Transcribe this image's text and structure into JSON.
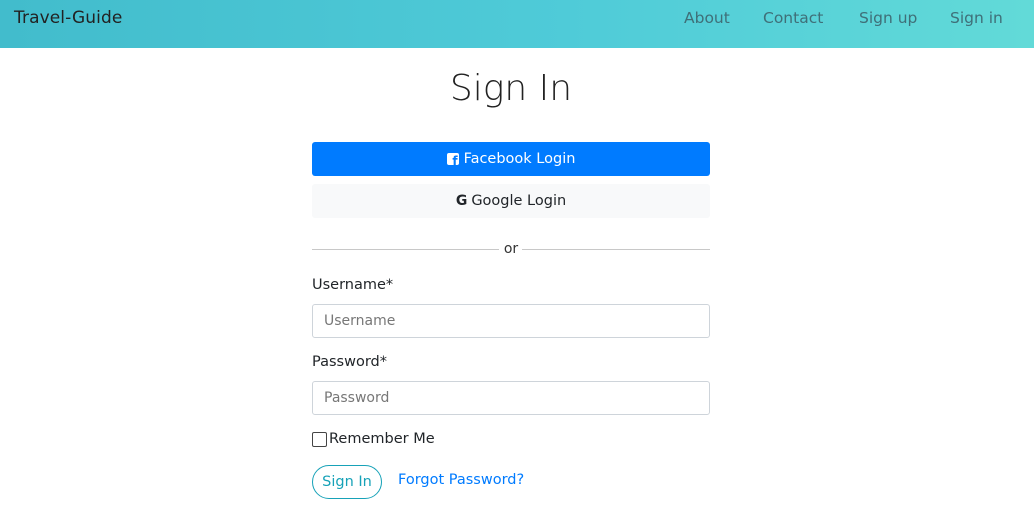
{
  "navbar": {
    "brand": "Travel-Guide",
    "links": [
      "About",
      "Contact",
      "Sign up",
      "Sign in"
    ]
  },
  "page": {
    "title": "Sign In"
  },
  "social": {
    "facebook_label": "Facebook Login",
    "google_label": "Google Login",
    "facebook_color": "#007bff"
  },
  "divider_text": "or",
  "form": {
    "username_label": "Username*",
    "username_placeholder": "Username",
    "username_value": "",
    "password_label": "Password*",
    "password_placeholder": "Password",
    "password_value": "",
    "remember_label": "Remember Me",
    "remember_checked": false,
    "submit_label": "Sign In",
    "forgot_label": "Forgot Password?"
  },
  "icons": {
    "facebook": "facebook-square-icon",
    "google": "google-g-icon"
  },
  "colors": {
    "navbar_gradient_start": "#42bccc",
    "navbar_gradient_end": "#62dad8",
    "accent_info": "#17a2b8",
    "link": "#007bff"
  }
}
